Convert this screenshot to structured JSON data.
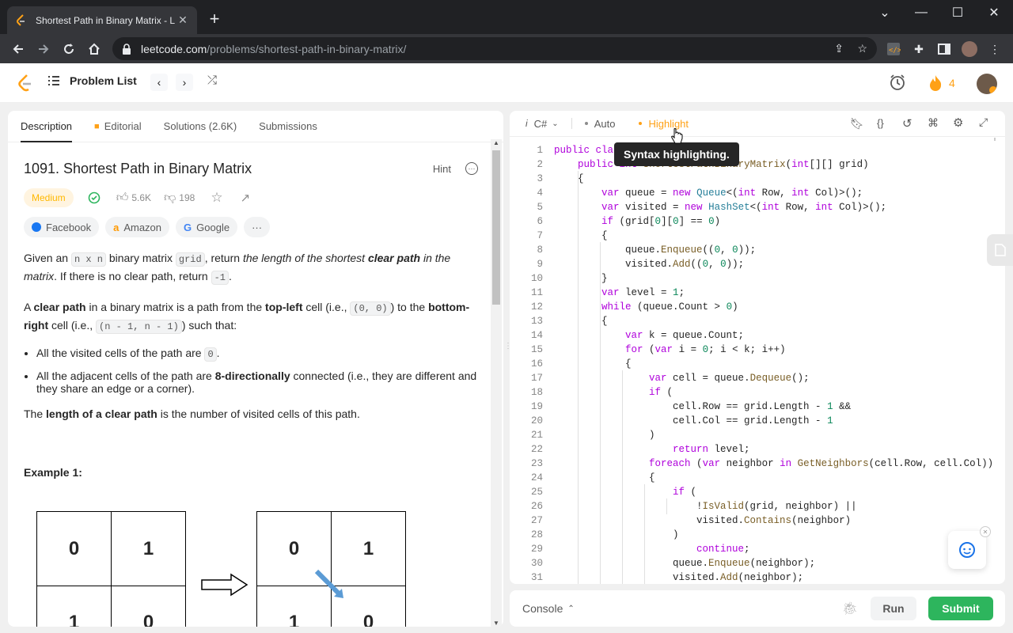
{
  "browser": {
    "tab_title": "Shortest Path in Binary Matrix - L",
    "url_host": "leetcode.com",
    "url_path": "/problems/shortest-path-in-binary-matrix/"
  },
  "nav": {
    "problem_list": "Problem List",
    "streak": "4"
  },
  "left": {
    "tabs": [
      "Description",
      "Editorial",
      "Solutions (2.6K)",
      "Submissions"
    ],
    "title": "1091. Shortest Path in Binary Matrix",
    "hint": "Hint",
    "difficulty": "Medium",
    "likes": "5.6K",
    "dislikes": "198",
    "companies": [
      "Facebook",
      "Amazon",
      "Google"
    ],
    "more": "···",
    "p1": {
      "a": "Given an ",
      "code1": "n x n",
      "b": " binary matrix ",
      "code2": "grid",
      "c": ", return ",
      "i1": "the length of the shortest ",
      "b1": "clear path",
      "i2": " in the matrix",
      "d": ". If there is no clear path, return ",
      "code3": "-1",
      "e": "."
    },
    "p2": {
      "a": "A ",
      "b1": "clear path",
      "b": " in a binary matrix is a path from the ",
      "b2": "top-left",
      "c": " cell (i.e., ",
      "code1": "(0, 0)",
      "d": ") to the ",
      "b3": "bottom-right",
      "e": " cell (i.e., ",
      "code2": "(n - 1, n - 1)",
      "f": ") such that:"
    },
    "bullet1": {
      "a": "All the visited cells of the path are ",
      "code": "0",
      "b": "."
    },
    "bullet2": {
      "a": "All the adjacent cells of the path are ",
      "b1": "8-directionally",
      "b": " connected (i.e., they are different and they share an edge or a corner)."
    },
    "p3": {
      "a": "The ",
      "b1": "length of a clear path",
      "b": " is the number of visited cells of this path."
    },
    "example_title": "Example 1:",
    "grid_values": {
      "a00": "0",
      "a01": "1",
      "a10": "1",
      "a11": "0",
      "b00": "0",
      "b01": "1",
      "b10": "1",
      "b11": "0"
    }
  },
  "editor": {
    "language": "C#",
    "auto": "Auto",
    "highlight": "Highlight",
    "tooltip": "Syntax highlighting.",
    "console": "Console",
    "run": "Run",
    "submit": "Submit"
  },
  "colors": {
    "accent": "#ffa116",
    "submit": "#2db55d",
    "medium_bg": "#fff4e0"
  }
}
